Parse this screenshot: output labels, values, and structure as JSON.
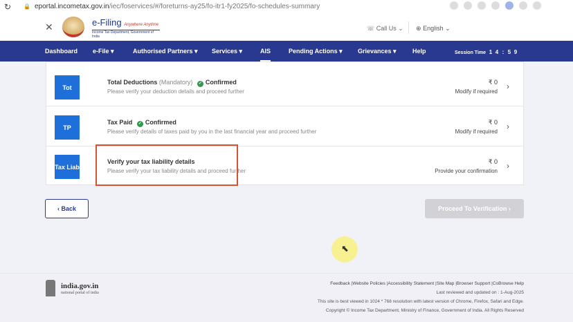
{
  "browser": {
    "url_host": "eportal.incometax.gov.in",
    "url_path": "/iec/foservices/#/foreturns-ay25/fo-itr1-fy2025/fo-schedules-summary"
  },
  "header": {
    "logo_title": "e-Filing",
    "logo_tagline": "Anywhere Anytime",
    "logo_subtitle": "Income Tax Department, Government of India",
    "call_us": "Call Us",
    "language": "English"
  },
  "nav": {
    "items": [
      "Dashboard",
      "e-File",
      "Authorised Partners",
      "Services",
      "AIS",
      "Pending Actions",
      "Grievances",
      "Help"
    ],
    "session_label": "Session Time",
    "session_digits": [
      "1",
      "4",
      ":",
      "5",
      "9"
    ]
  },
  "rows": [
    {
      "badge": "Tot",
      "title": "Total Deductions",
      "optional": "(Mandatory)",
      "status": "Confirmed",
      "desc": "Please verify your deduction details and proceed further",
      "amount": "₹ 0",
      "action": "Modify if required"
    },
    {
      "badge": "TP",
      "title": "Tax Paid",
      "optional": "",
      "status": "Confirmed",
      "desc": "Please verify details of taxes paid by you in the last financial year and proceed further",
      "amount": "₹ 0",
      "action": "Modify if required"
    },
    {
      "badge": "Tax Liab",
      "title": "Verify your tax liability details",
      "optional": "",
      "status": "",
      "desc": "Please verify your tax liability details and proceed further",
      "amount": "₹ 0",
      "action": "Provide your confirmation"
    }
  ],
  "buttons": {
    "back": "Back",
    "proceed": "Proceed To Verification"
  },
  "footer": {
    "site": "india.gov.in",
    "site_sub": "national portal of india",
    "links": [
      "Feedback",
      "Website Policies",
      "Accessibility Statement",
      "Site Map",
      "Browser Support",
      "CoBrowse Help"
    ],
    "reviewed": "Last reviewed and updated on : 1-Aug-2025",
    "best_viewed": "This site is best viewed in 1024 * 768 resolution with latest version of Chrome, Firefox, Safari and Edge.",
    "copyright": "Copyright © Income Tax Department, Ministry of Finance, Government of India. All Rights Reserved"
  }
}
